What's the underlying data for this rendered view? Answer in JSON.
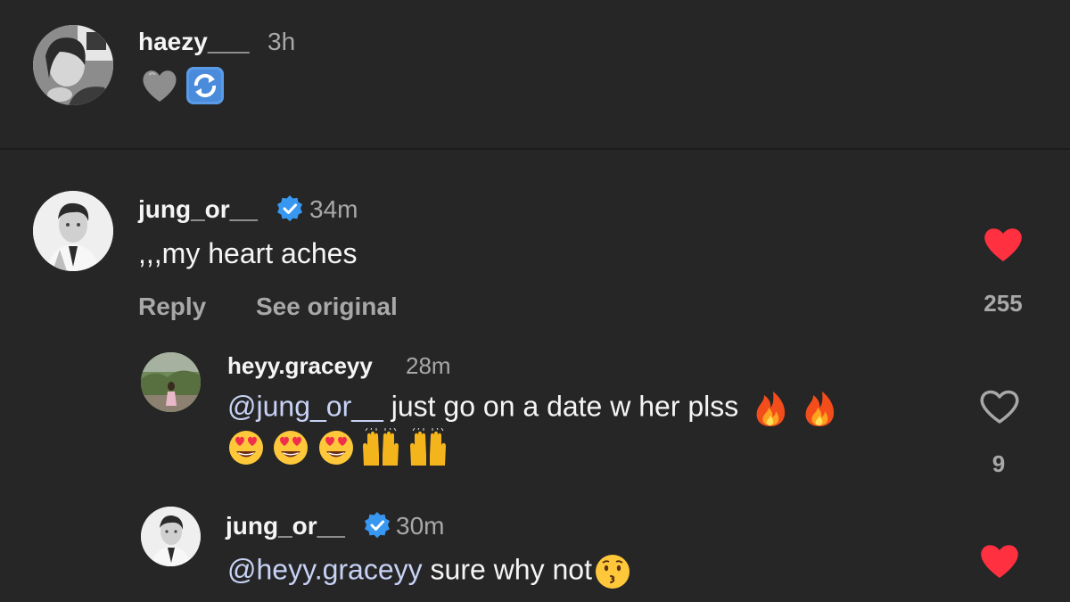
{
  "comments": [
    {
      "username": "haezy___",
      "time": "3h",
      "emojis": [
        "grey-heart-emoji",
        "arrows-cycle-emoji"
      ]
    },
    {
      "username": "jung_or__",
      "verified": true,
      "time": "34m",
      "text": ",,,my heart aches",
      "reply_label": "Reply",
      "see_original_label": "See original",
      "likes": "255",
      "liked": true
    }
  ],
  "replies": [
    {
      "username": "heyy.graceyy",
      "time": "28m",
      "mention": "@jung_or__",
      "text": " just go on a date w her plss",
      "emojis_line1": [
        "fire-emoji",
        "fire-emoji"
      ],
      "emojis_line2": [
        "heart-eyes-emoji",
        "heart-eyes-emoji",
        "heart-eyes-emoji",
        "raised-hands-emoji",
        "raised-hands-emoji"
      ],
      "likes": "9",
      "liked": false
    },
    {
      "username": "jung_or__",
      "verified": true,
      "time": "30m",
      "mention": "@heyy.graceyy",
      "text": " sure why not",
      "emojis": [
        "kissing-face-emoji"
      ],
      "liked": true
    }
  ],
  "colors": {
    "background": "#262626",
    "like_red": "#ff3040",
    "verified_blue": "#3897f0",
    "muted_text": "#a8a8a8",
    "mention": "#c7d2f5"
  }
}
